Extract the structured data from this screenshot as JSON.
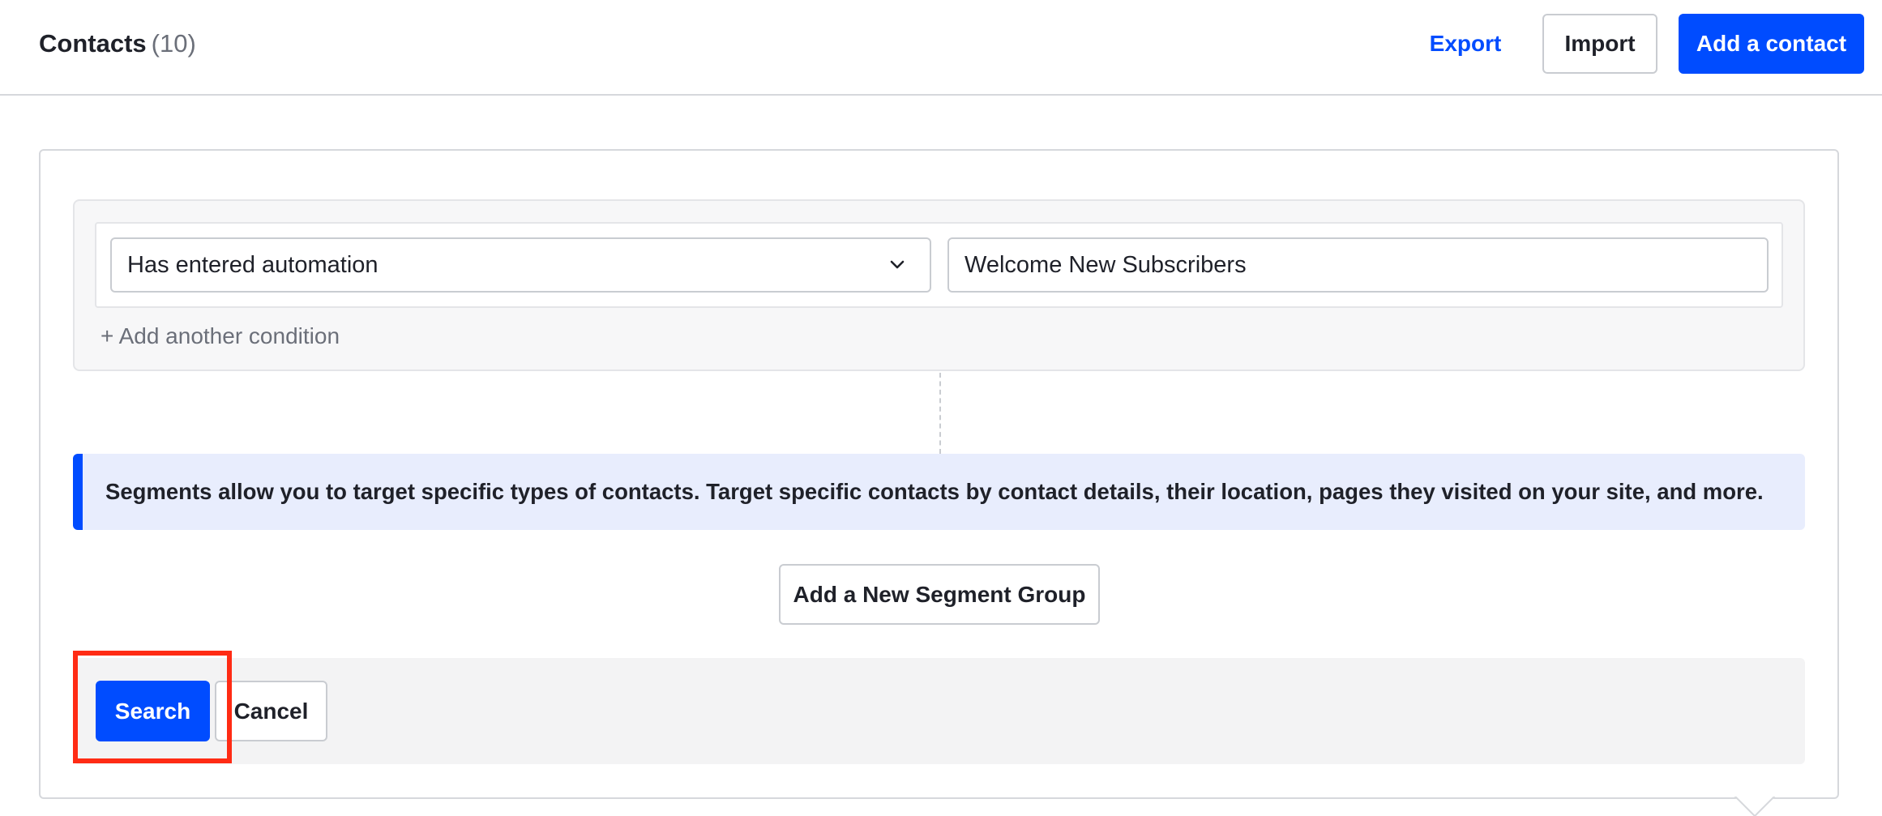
{
  "header": {
    "title": "Contacts",
    "count": "(10)",
    "export_label": "Export",
    "import_label": "Import",
    "add_contact_label": "Add a contact"
  },
  "condition": {
    "type_selected": "Has entered automation",
    "value": "Welcome New Subscribers",
    "add_condition_label": "+ Add another condition"
  },
  "info": {
    "message": "Segments allow you to target specific types of contacts. Target specific contacts by contact details, their location, pages they visited on your site, and more."
  },
  "actions": {
    "add_segment_group_label": "Add a New Segment Group",
    "search_label": "Search",
    "cancel_label": "Cancel"
  },
  "icons": {
    "select_chevron": "chevron-down-icon"
  },
  "colors": {
    "primary": "#004cff",
    "highlight": "#ff2b14",
    "info_background": "#e8edfd",
    "text": "#1f2129",
    "muted_text": "#6b6f79"
  }
}
